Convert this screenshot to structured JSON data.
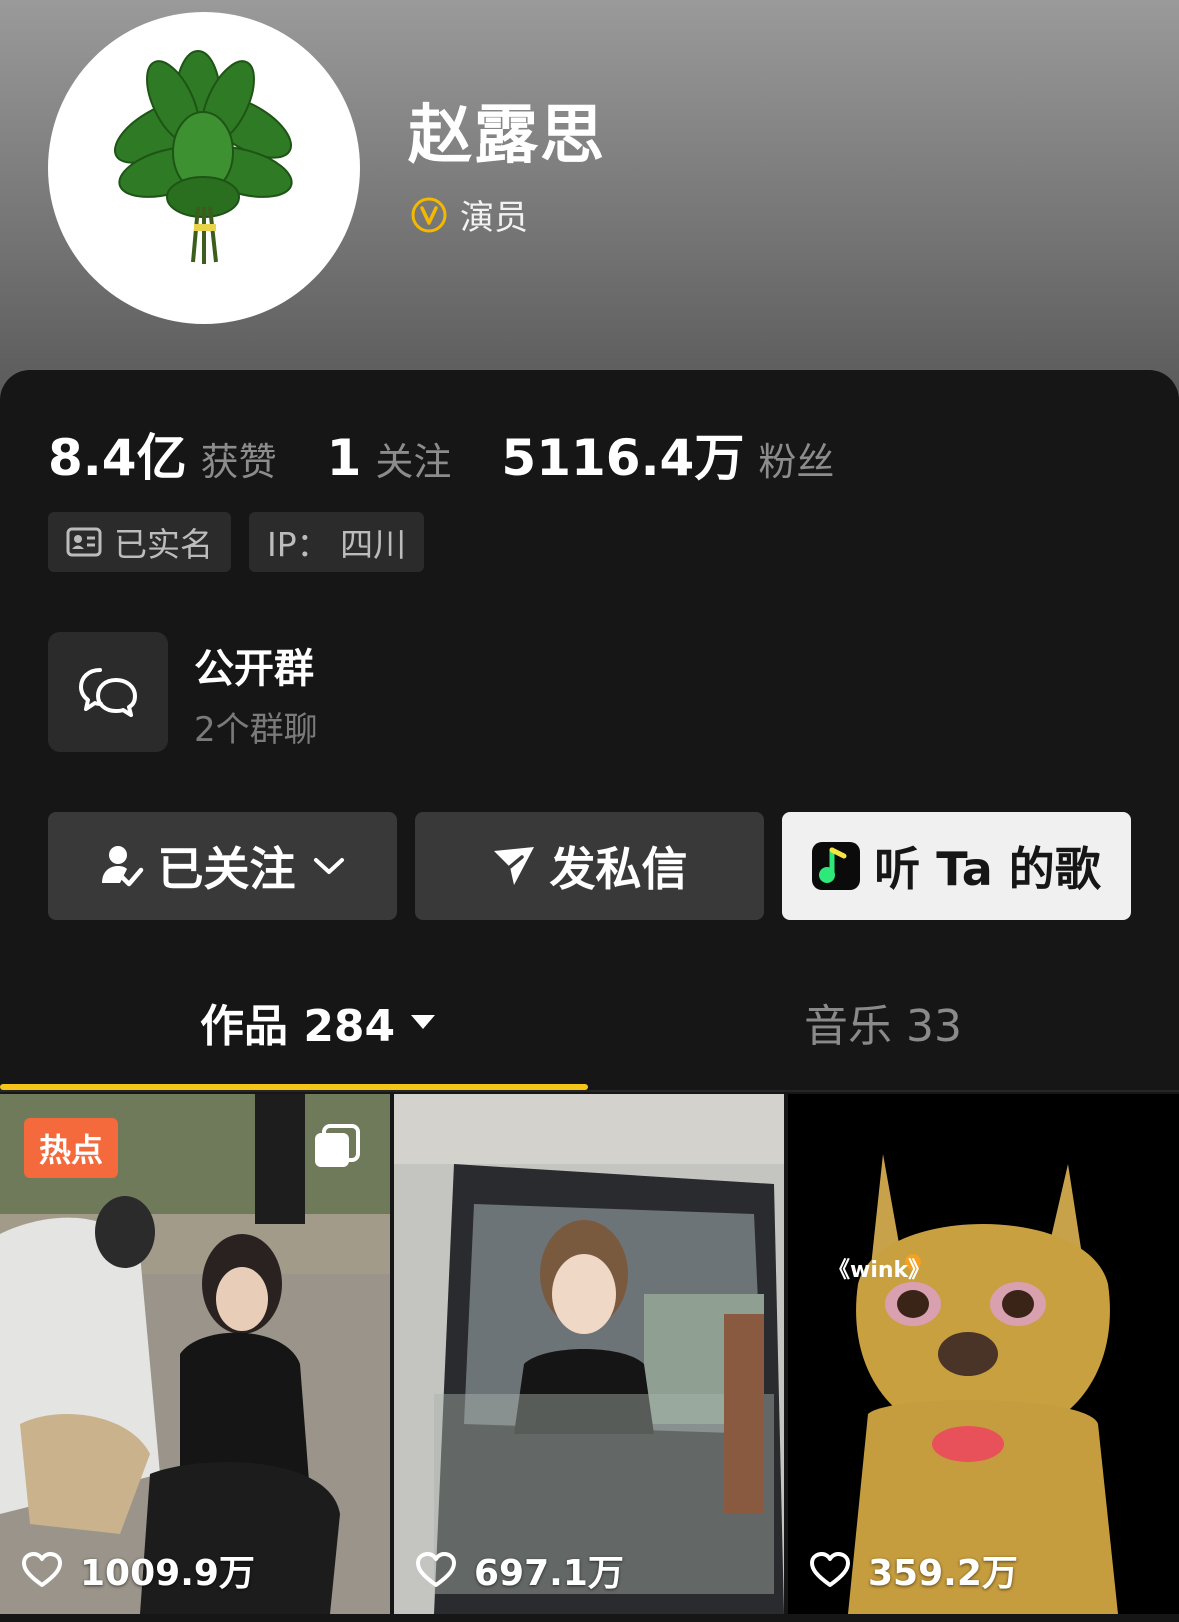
{
  "profile": {
    "name": "赵露思",
    "verification": "演员",
    "colors": {
      "verify_badge": "#f5b800",
      "accent": "#f5c518"
    }
  },
  "stats": [
    {
      "value": "8.4亿",
      "label": "获赞"
    },
    {
      "value": "1",
      "label": "关注"
    },
    {
      "value": "5116.4万",
      "label": "粉丝"
    }
  ],
  "tags": {
    "real_name": "已实名",
    "ip": "IP：  四川"
  },
  "group": {
    "title": "公开群",
    "subtitle": "2个群聊"
  },
  "actions": {
    "follow": "已关注",
    "message": "发私信",
    "song": "听 Ta 的歌"
  },
  "tabs": {
    "works": "作品 284",
    "music": "音乐 33"
  },
  "videos": [
    {
      "likes": "1009.9万",
      "badge": "热点"
    },
    {
      "likes": "697.1万"
    },
    {
      "likes": "359.2万",
      "caption": "《wink》"
    }
  ]
}
